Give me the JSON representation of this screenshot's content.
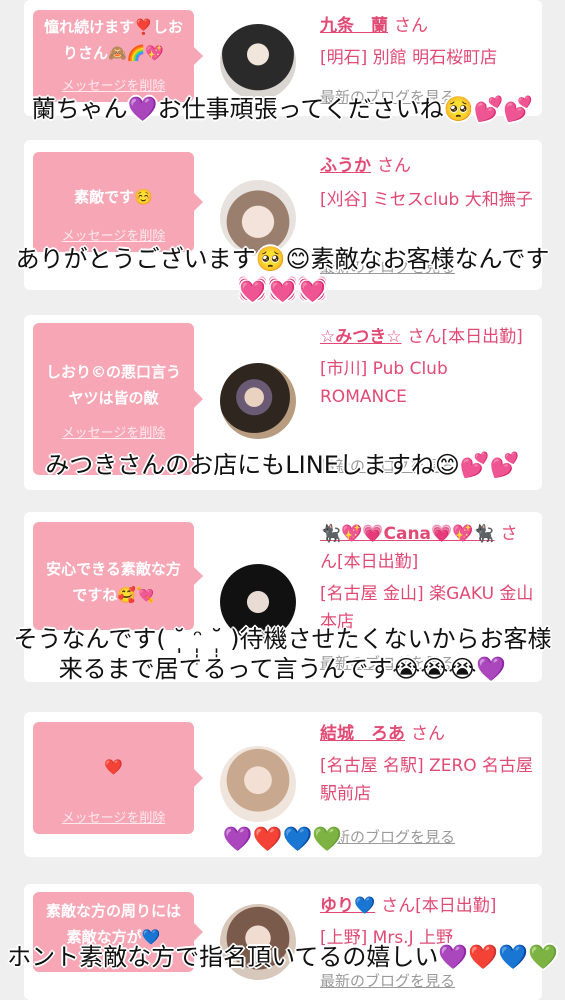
{
  "delete_label": "メッセージを削除",
  "blog_label": "最新のブログを見る",
  "san": "さん",
  "cards": [
    {
      "message": "憧れ続けます❣️しおりさん🙈🌈💖",
      "name": "九条　蘭",
      "san_suffix": "さん",
      "shop": "[明石] 別館 明石桜町店"
    },
    {
      "message": "素敵です☺️",
      "name": "ふうか",
      "san_suffix": "さん",
      "shop": "[刈谷] ミセスclub 大和撫子"
    },
    {
      "message": "しおり©の悪口言うヤツは皆の敵",
      "name": "☆みつき☆",
      "san_suffix": "さん[本日出勤]",
      "shop": "[市川] Pub Club ROMANCE"
    },
    {
      "message": "安心できる素敵な方ですね🥰💘",
      "name": "🐈‍⬛💖💗Cana💗💖🐈‍⬛",
      "san_suffix": "さん[本日出勤]",
      "shop": "[名古屋 金山] 楽GAKU 金山本店"
    },
    {
      "message": "❤️",
      "name": "結城　ろあ",
      "san_suffix": "さん",
      "shop": "[名古屋 名駅] ZERO 名古屋駅前店"
    },
    {
      "message": "素敵な方の周りには素敵な方が💙",
      "name": "ゆり💙",
      "san_suffix": "さん[本日出勤]",
      "shop": "[上野] Mrs.J 上野"
    }
  ],
  "captions": [
    "蘭ちゃん💜お仕事頑張ってくださいね🥺💕💕",
    "ありがとうございます🥺😊素敵なお客様なんです💓💓💓",
    "みつきさんのお店にもLINEしますね😊💕💕",
    "そうなんです( ˘̩̩̩ ᵔ̩̩̩ ˘̩̩̩ )待機させたくないからお客様来るまで居てるって言うんです😭😭😭💜",
    "💜❤️💙💚",
    "ホント素敵な方で指名頂いてるの嬉しい💜❤️💙💚"
  ]
}
